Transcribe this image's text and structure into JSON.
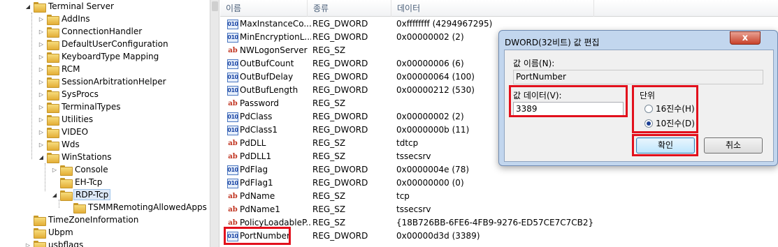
{
  "tree": {
    "items": [
      {
        "label": "Terminal Server",
        "expanded": true
      },
      {
        "label": "AddIns"
      },
      {
        "label": "ConnectionHandler"
      },
      {
        "label": "DefaultUserConfiguration"
      },
      {
        "label": "KeyboardType Mapping"
      },
      {
        "label": "RCM"
      },
      {
        "label": "SessionArbitrationHelper"
      },
      {
        "label": "SysProcs"
      },
      {
        "label": "TerminalTypes"
      },
      {
        "label": "Utilities"
      },
      {
        "label": "VIDEO"
      },
      {
        "label": "Wds"
      },
      {
        "label": "WinStations",
        "expanded": true
      },
      {
        "label": "Console"
      },
      {
        "label": "EH-Tcp"
      },
      {
        "label": "RDP-Tcp",
        "expanded": true,
        "selected": true
      },
      {
        "label": "TSMMRemotingAllowedApps"
      },
      {
        "label": "TimeZoneInformation"
      },
      {
        "label": "Ubpm"
      },
      {
        "label": "usbflags"
      }
    ]
  },
  "list": {
    "headers": {
      "name": "이름",
      "type": "종류",
      "data": "데이터"
    },
    "rows": [
      {
        "name": "MaxInstanceCo...",
        "type": "REG_DWORD",
        "data": "0xffffffff (4294967295)",
        "icon": "dword"
      },
      {
        "name": "MinEncryptionL...",
        "type": "REG_DWORD",
        "data": "0x00000002 (2)",
        "icon": "dword"
      },
      {
        "name": "NWLogonServer",
        "type": "REG_SZ",
        "data": "",
        "icon": "string"
      },
      {
        "name": "OutBufCount",
        "type": "REG_DWORD",
        "data": "0x00000006 (6)",
        "icon": "dword"
      },
      {
        "name": "OutBufDelay",
        "type": "REG_DWORD",
        "data": "0x00000064 (100)",
        "icon": "dword"
      },
      {
        "name": "OutBufLength",
        "type": "REG_DWORD",
        "data": "0x00000212 (530)",
        "icon": "dword"
      },
      {
        "name": "Password",
        "type": "REG_SZ",
        "data": "",
        "icon": "string"
      },
      {
        "name": "PdClass",
        "type": "REG_DWORD",
        "data": "0x00000002 (2)",
        "icon": "dword"
      },
      {
        "name": "PdClass1",
        "type": "REG_DWORD",
        "data": "0x0000000b (11)",
        "icon": "dword"
      },
      {
        "name": "PdDLL",
        "type": "REG_SZ",
        "data": "tdtcp",
        "icon": "string"
      },
      {
        "name": "PdDLL1",
        "type": "REG_SZ",
        "data": "tssecsrv",
        "icon": "string"
      },
      {
        "name": "PdFlag",
        "type": "REG_DWORD",
        "data": "0x0000004e (78)",
        "icon": "dword"
      },
      {
        "name": "PdFlag1",
        "type": "REG_DWORD",
        "data": "0x00000000 (0)",
        "icon": "dword"
      },
      {
        "name": "PdName",
        "type": "REG_SZ",
        "data": "tcp",
        "icon": "string"
      },
      {
        "name": "PdName1",
        "type": "REG_SZ",
        "data": "tssecsrv",
        "icon": "string"
      },
      {
        "name": "PolicyLoadableP...",
        "type": "REG_SZ",
        "data": "{18B726BB-6FE6-4FB9-9276-ED57CE7C7CB2}",
        "icon": "string"
      },
      {
        "name": "PortNumber",
        "type": "REG_DWORD",
        "data": "0x00000d3d (3389)",
        "icon": "dword"
      }
    ]
  },
  "dialog": {
    "title": "DWORD(32비트) 값 편집",
    "close": "x",
    "value_name_label": "값 이름(N):",
    "value_name": "PortNumber",
    "value_data_label": "값 데이터(V):",
    "value_data": "3389",
    "base_label": "단위",
    "radio_hex": "16진수(H)",
    "radio_dec": "10진수(D)",
    "selected_base": "dec",
    "ok": "확인",
    "cancel": "취소"
  },
  "colors": {
    "highlight_red": "#e2101c",
    "dialog_frame": "#c2d6ee"
  }
}
